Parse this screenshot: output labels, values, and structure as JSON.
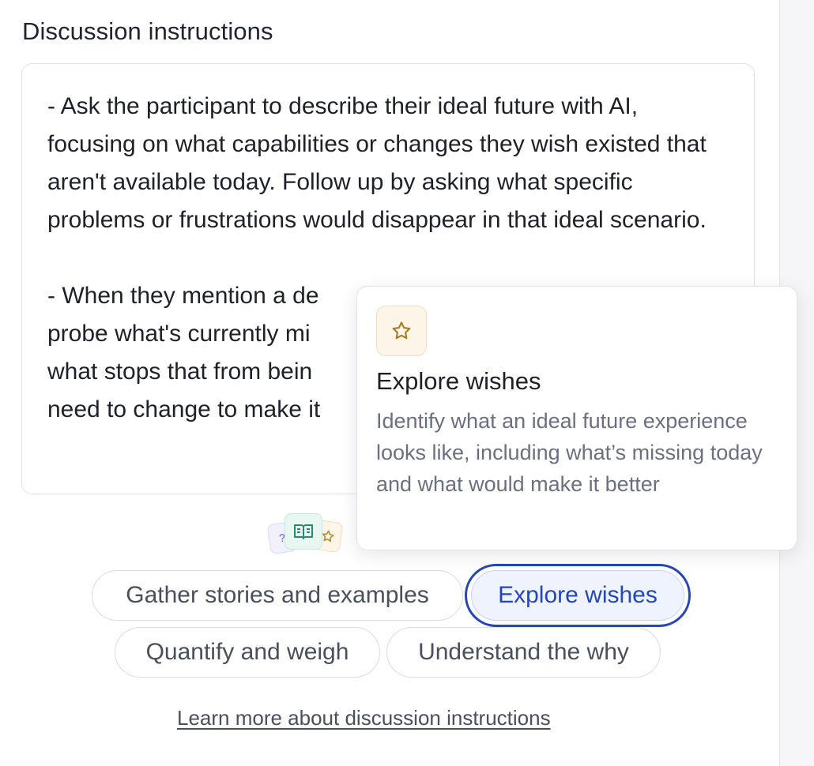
{
  "section": {
    "title": "Discussion instructions"
  },
  "instructions": {
    "text": "- Ask the participant to describe their ideal future with AI, focusing on what capabilities or changes they wish existed that aren't available today. Follow up by asking what specific problems or frustrations would disappear in that ideal scenario.\n\n- When they mention a de\nprobe what's currently mi\nwhat stops that from bein\nneed to change to make it"
  },
  "icons": {
    "cluster": [
      "question-icon",
      "book-icon",
      "star-icon"
    ]
  },
  "tooltip": {
    "icon": "star-icon",
    "title": "Explore wishes",
    "description": "Identify what an ideal future experience looks like, including what’s missing today and what would make it better"
  },
  "chips": {
    "gather": "Gather stories and examples",
    "wishes": "Explore wishes",
    "quantify": "Quantify and weigh",
    "why": "Understand the why"
  },
  "learn_more": "Learn more about discussion instructions",
  "colors": {
    "accent": "#2546b8",
    "star": "#b5862a",
    "book": "#2a8a6e",
    "question": "#6a5fc8"
  }
}
